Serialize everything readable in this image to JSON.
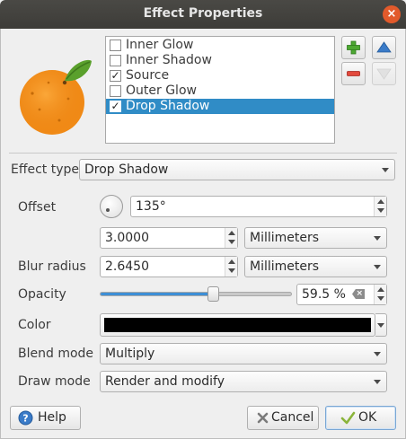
{
  "window": {
    "title": "Effect Properties",
    "close_glyph": "×"
  },
  "preview": {
    "icon": "orange-fruit-preview",
    "colors": {
      "orange": "#f39220",
      "leaf": "#5aa02c"
    }
  },
  "effects": {
    "items": [
      {
        "label": "Inner Glow",
        "checked": false,
        "checkmark": ""
      },
      {
        "label": "Inner Shadow",
        "checked": false,
        "checkmark": ""
      },
      {
        "label": "Source",
        "checked": true,
        "checkmark": "✓"
      },
      {
        "label": "Outer Glow",
        "checked": false,
        "checkmark": ""
      },
      {
        "label": "Drop Shadow",
        "checked": true,
        "checkmark": "✓",
        "selected": true
      }
    ],
    "buttons": {
      "add": "plus-icon",
      "remove": "minus-icon",
      "move_up": "up-arrow-icon",
      "move_down": "down-arrow-icon"
    }
  },
  "effect_type": {
    "label": "Effect type",
    "value": "Drop Shadow"
  },
  "offset": {
    "label": "Offset",
    "angle": "135°",
    "distance": "3.0000",
    "unit": "Millimeters"
  },
  "blur_radius": {
    "label": "Blur radius",
    "value": "2.6450",
    "unit": "Millimeters"
  },
  "opacity": {
    "label": "Opacity",
    "value": "59.5 %",
    "fraction": 0.595
  },
  "color": {
    "label": "Color",
    "value": "#000000"
  },
  "blend_mode": {
    "label": "Blend mode",
    "value": "Multiply"
  },
  "draw_mode": {
    "label": "Draw mode",
    "value": "Render and modify"
  },
  "footer": {
    "help": "Help",
    "cancel": "Cancel",
    "ok": "OK"
  },
  "colors": {
    "selection": "#308cc6",
    "accent": "#3d8fd6",
    "titlebar": "#3d3c38",
    "close": "#e25a2b"
  }
}
